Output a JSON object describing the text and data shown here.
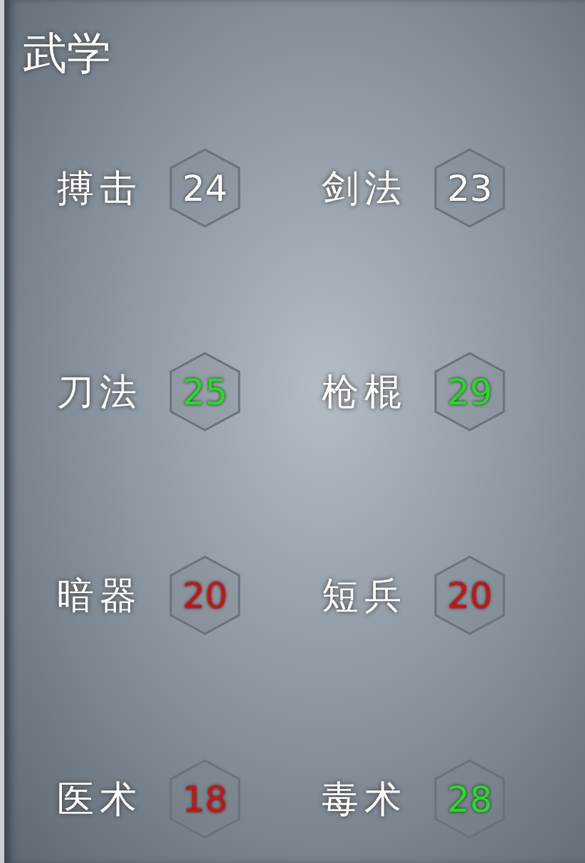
{
  "title": "武学",
  "skills": [
    {
      "name": "搏击",
      "value": "24",
      "color": "#ffffff"
    },
    {
      "name": "剑法",
      "value": "23",
      "color": "#ffffff"
    },
    {
      "name": "刀法",
      "value": "25",
      "color": "#22dd22"
    },
    {
      "name": "枪棍",
      "value": "29",
      "color": "#22dd22"
    },
    {
      "name": "暗器",
      "value": "20",
      "color": "#d01010"
    },
    {
      "name": "短兵",
      "value": "20",
      "color": "#d01010"
    },
    {
      "name": "医术",
      "value": "18",
      "color": "#d01010"
    },
    {
      "name": "毒术",
      "value": "28",
      "color": "#22dd22"
    }
  ]
}
